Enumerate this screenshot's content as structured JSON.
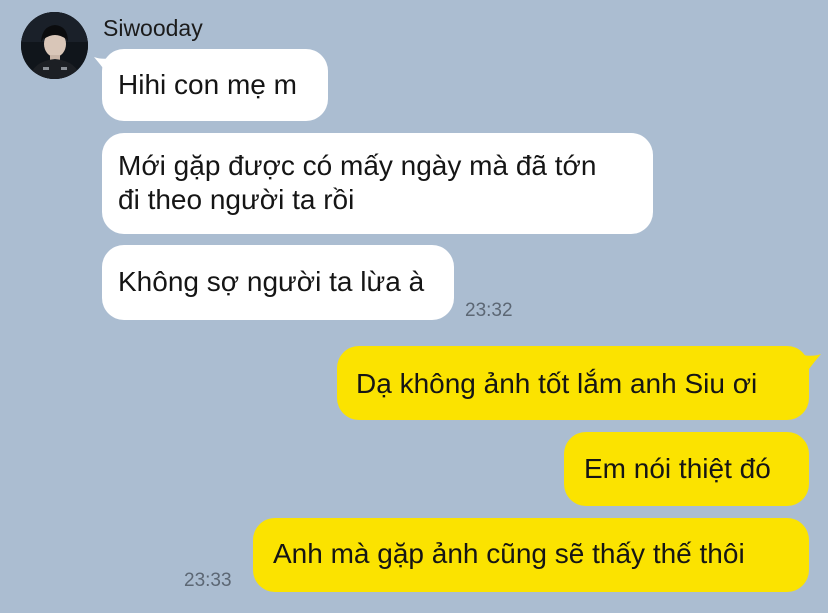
{
  "sender": {
    "name": "Siwooday"
  },
  "messages": {
    "incoming": [
      {
        "text": "Hihi con mẹ m"
      },
      {
        "line1": "Mới gặp được có mấy ngày mà đã tớn",
        "line2": "đi theo người ta rồi"
      },
      {
        "text": "Không sợ người ta lừa à"
      }
    ],
    "incoming_time": "23:32",
    "outgoing": [
      {
        "text": "Dạ không ảnh tốt lắm anh Siu ơi"
      },
      {
        "text": "Em nói thiệt đó"
      },
      {
        "text": "Anh mà gặp ảnh cũng sẽ thấy thế thôi"
      }
    ],
    "outgoing_time": "23:33"
  },
  "colors": {
    "background": "#abbdd1",
    "incoming_bubble": "#ffffff",
    "outgoing_bubble": "#fbe300"
  }
}
